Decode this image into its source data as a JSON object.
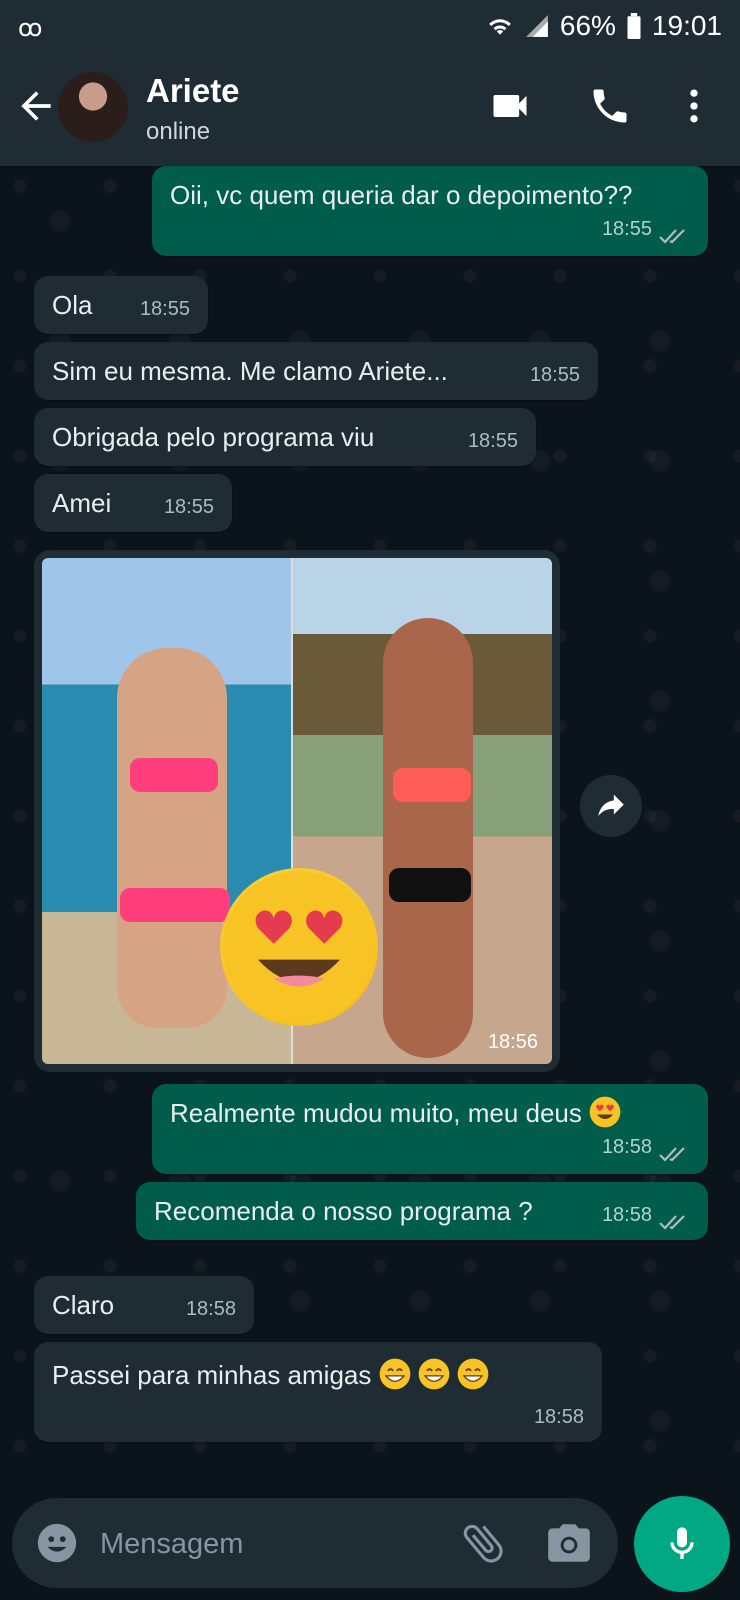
{
  "status_bar": {
    "battery": "66%",
    "time": "19:01"
  },
  "header": {
    "contact_name": "Ariete",
    "presence": "online"
  },
  "messages": [
    {
      "dir": "out",
      "text": "Oii, vc quem queria dar o depoimento??",
      "time": "18:55",
      "status": "read"
    },
    {
      "dir": "in",
      "text": "Ola",
      "time": "18:55"
    },
    {
      "dir": "in",
      "text": "Sim eu mesma. Me clamo Ariete...",
      "time": "18:55"
    },
    {
      "dir": "in",
      "text": "Obrigada pelo programa viu",
      "time": "18:55"
    },
    {
      "dir": "in",
      "text": "Amei",
      "time": "18:55"
    },
    {
      "dir": "in",
      "type": "image",
      "time": "18:56"
    },
    {
      "dir": "out",
      "text": "Realmente mudou muito, meu deus",
      "emoji": "heart-eyes",
      "time": "18:58",
      "status": "read"
    },
    {
      "dir": "out",
      "text": "Recomenda o nosso programa ?",
      "time": "18:58",
      "status": "read"
    },
    {
      "dir": "in",
      "text": "Claro",
      "time": "18:58"
    },
    {
      "dir": "in",
      "text": "Passei para minhas amigas",
      "emoji": "grinning-x3",
      "time": "18:58"
    }
  ],
  "composer": {
    "placeholder": "Mensagem"
  },
  "colors": {
    "header_bg": "#1f2c34",
    "chat_bg": "#0b141a",
    "incoming_bubble": "#1f2c34",
    "outgoing_bubble": "#005c4b",
    "mic_button": "#00a884"
  },
  "icons": [
    "voicemail-icon",
    "wifi-icon",
    "signal-icon",
    "battery-icon",
    "back-arrow-icon",
    "video-call-icon",
    "phone-icon",
    "more-options-icon",
    "read-ticks-icon",
    "share-forward-icon",
    "emoji-icon",
    "attach-paperclip-icon",
    "camera-icon",
    "mic-icon"
  ]
}
